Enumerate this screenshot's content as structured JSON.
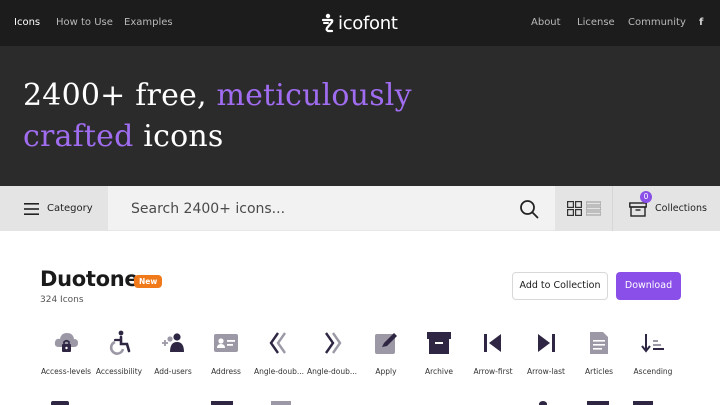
{
  "nav": {
    "left": [
      "Icons",
      "How to Use",
      "Examples"
    ],
    "logo": "icofont",
    "right": [
      "About",
      "License",
      "Community",
      "f"
    ]
  },
  "hero": {
    "line1_a": "2400+ free, ",
    "line1_b": "meticulously",
    "line2_a": "crafted",
    "line2_b": " icons"
  },
  "search": {
    "category_label": "Category",
    "placeholder": "Search 2400+ icons...",
    "collections_label": "Collections",
    "collections_count": "0"
  },
  "section": {
    "title": "Duotone",
    "badge": "New",
    "count": "324 Icons",
    "add_label": "Add to Collection",
    "download_label": "Download"
  },
  "icons": [
    {
      "label": "Access-levels",
      "icon": "cloud-lock-icon"
    },
    {
      "label": "Accessibility",
      "icon": "wheelchair-icon"
    },
    {
      "label": "Add-users",
      "icon": "add-users-icon"
    },
    {
      "label": "Address",
      "icon": "address-card-icon"
    },
    {
      "label": "Angle-doub...",
      "icon": "angle-double-left-icon"
    },
    {
      "label": "Angle-doub...",
      "icon": "angle-double-right-icon"
    },
    {
      "label": "Apply",
      "icon": "apply-icon"
    },
    {
      "label": "Archive",
      "icon": "archive-icon"
    },
    {
      "label": "Arrow-first",
      "icon": "arrow-first-icon"
    },
    {
      "label": "Arrow-last",
      "icon": "arrow-last-icon"
    },
    {
      "label": "Articles",
      "icon": "articles-icon"
    },
    {
      "label": "Ascending",
      "icon": "ascending-icon"
    }
  ],
  "colors": {
    "dark": "#2e2642",
    "light": "#9c98a6",
    "accent": "#8a4fe8",
    "badge": "#f07a1a"
  }
}
